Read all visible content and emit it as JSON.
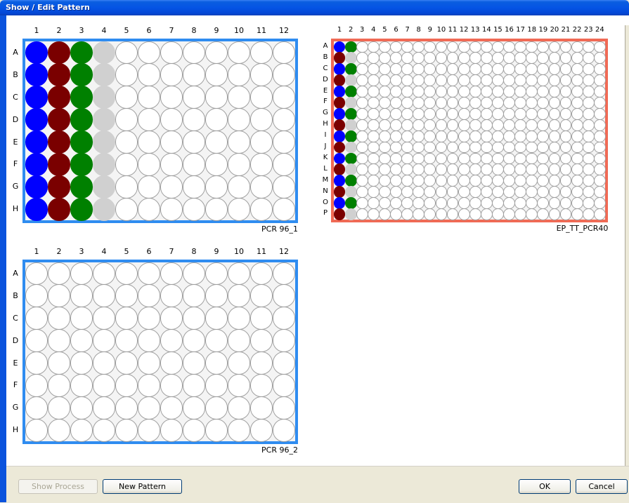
{
  "window": {
    "title": "Show / Edit Pattern"
  },
  "colors": {
    "blue": "#0000ff",
    "red": "#7a0000",
    "green": "#008000",
    "gray": "#d0d0d0",
    "empty": "#ffffff",
    "plate_blue": "#2f8cf0",
    "plate_red": "#f06a55"
  },
  "plates": [
    {
      "name": "PCR 96_1",
      "rows": [
        "A",
        "B",
        "C",
        "D",
        "E",
        "F",
        "G",
        "H"
      ],
      "cols": [
        "1",
        "2",
        "3",
        "4",
        "5",
        "6",
        "7",
        "8",
        "9",
        "10",
        "11",
        "12"
      ],
      "filled_columns": [
        {
          "col": "1",
          "rows": [
            "A",
            "B",
            "C",
            "D",
            "E",
            "F",
            "G",
            "H"
          ],
          "color": "blue"
        },
        {
          "col": "2",
          "rows": [
            "A",
            "B",
            "C",
            "D",
            "E",
            "F",
            "G",
            "H"
          ],
          "color": "red"
        },
        {
          "col": "3",
          "rows": [
            "A",
            "B",
            "C",
            "D",
            "E",
            "F",
            "G",
            "H"
          ],
          "color": "green"
        },
        {
          "col": "4",
          "rows": [
            "A",
            "B",
            "C",
            "D",
            "E",
            "F",
            "G",
            "H"
          ],
          "color": "gray"
        }
      ],
      "border_color": "plate_blue"
    },
    {
      "name": "EP_TT_PCR40",
      "rows": [
        "A",
        "B",
        "C",
        "D",
        "E",
        "F",
        "G",
        "H",
        "I",
        "J",
        "K",
        "L",
        "M",
        "N",
        "O",
        "P"
      ],
      "cols": [
        "1",
        "2",
        "3",
        "4",
        "5",
        "6",
        "7",
        "8",
        "9",
        "10",
        "11",
        "12",
        "13",
        "14",
        "15",
        "16",
        "17",
        "18",
        "19",
        "20",
        "21",
        "22",
        "23",
        "24"
      ],
      "filled_columns": [
        {
          "col": "1",
          "rows": [
            "A",
            "C",
            "E",
            "G",
            "I",
            "K",
            "M",
            "O"
          ],
          "color": "blue"
        },
        {
          "col": "1",
          "rows": [
            "B",
            "D",
            "F",
            "H",
            "J",
            "L",
            "N",
            "P"
          ],
          "color": "red"
        },
        {
          "col": "2",
          "rows": [
            "A",
            "C",
            "E",
            "G",
            "I",
            "K",
            "M",
            "O"
          ],
          "color": "green"
        },
        {
          "col": "2",
          "rows": [
            "B",
            "D",
            "F",
            "H",
            "J",
            "L",
            "N",
            "P"
          ],
          "color": "gray"
        }
      ],
      "border_color": "plate_red"
    },
    {
      "name": "PCR 96_2",
      "rows": [
        "A",
        "B",
        "C",
        "D",
        "E",
        "F",
        "G",
        "H"
      ],
      "cols": [
        "1",
        "2",
        "3",
        "4",
        "5",
        "6",
        "7",
        "8",
        "9",
        "10",
        "11",
        "12"
      ],
      "filled_columns": [],
      "border_color": "plate_blue"
    }
  ],
  "buttons": {
    "show_process": "Show Process",
    "new_pattern": "New Pattern",
    "ok": "OK",
    "cancel": "Cancel"
  }
}
